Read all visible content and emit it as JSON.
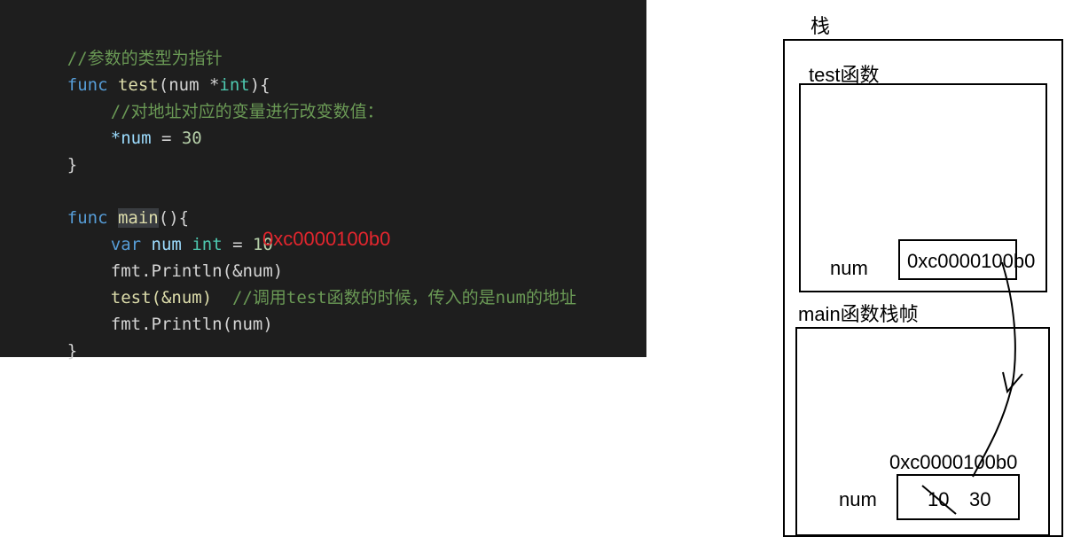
{
  "code": {
    "comment_header": "//参数的类型为指针",
    "kw_func": "func",
    "fn_test": "test",
    "test_params_open": "(num ",
    "star": "*",
    "kw_int": "int",
    "brace_open": "){",
    "comment_modify": "//对地址对应的变量进行改变数值：",
    "deref_num": "*num",
    "assign_eq": " = ",
    "val_30": "30",
    "brace_close": "}",
    "fn_main": "main",
    "main_parens": "(){",
    "kw_var": "var",
    "var_num": "num",
    "val_10": "10",
    "fmt_println_addr": "fmt.Println(&num)",
    "test_call": "test(&num)",
    "comment_call": "//调用test函数的时候，传入的是num的地址",
    "fmt_println_num": "fmt.Println(num)",
    "printed_address": "0xc0000100b0"
  },
  "diagram": {
    "stack_title": "栈",
    "test_frame_title": "test函数",
    "test_num_label": "num",
    "test_num_value": "0xc0000100b0",
    "main_frame_title": "main函数栈帧",
    "main_num_address": "0xc0000100b0",
    "main_num_label": "num",
    "main_num_old_value": "10",
    "main_num_new_value": "30"
  }
}
